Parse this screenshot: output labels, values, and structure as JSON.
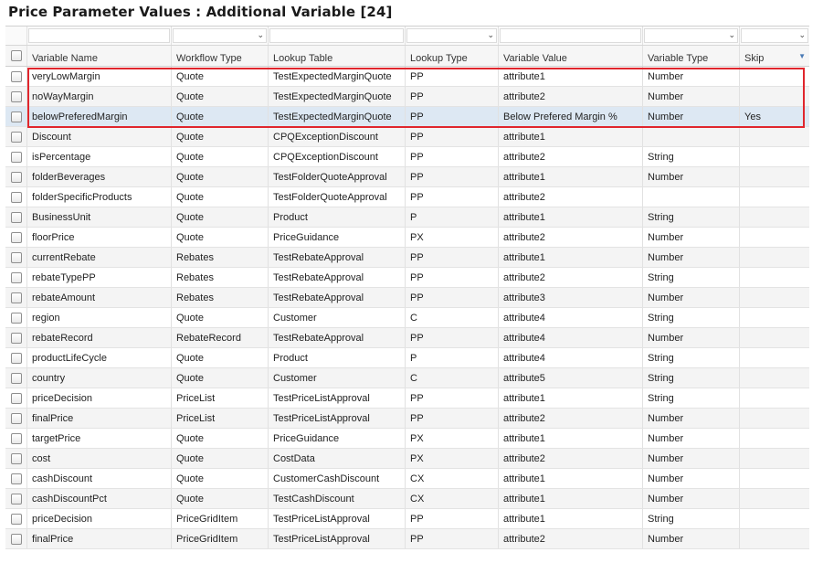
{
  "page": {
    "title": "Price Parameter Values : Additional Variable [24]"
  },
  "columns": [
    {
      "label": "Variable Name",
      "has_filter_dropdown": false
    },
    {
      "label": "Workflow Type",
      "has_filter_dropdown": true
    },
    {
      "label": "Lookup Table",
      "has_filter_dropdown": false
    },
    {
      "label": "Lookup Type",
      "has_filter_dropdown": true
    },
    {
      "label": "Variable Value",
      "has_filter_dropdown": false
    },
    {
      "label": "Variable Type",
      "has_filter_dropdown": true
    },
    {
      "label": "Skip",
      "has_filter_dropdown": true,
      "sort_indicator": "sort-desc-icon"
    }
  ],
  "rows": [
    [
      "veryLowMargin",
      "Quote",
      "TestExpectedMarginQuote",
      "PP",
      "attribute1",
      "Number",
      ""
    ],
    [
      "noWayMargin",
      "Quote",
      "TestExpectedMarginQuote",
      "PP",
      "attribute2",
      "Number",
      ""
    ],
    [
      "belowPreferedMargin",
      "Quote",
      "TestExpectedMarginQuote",
      "PP",
      "Below Prefered Margin %",
      "Number",
      "Yes"
    ],
    [
      "Discount",
      "Quote",
      "CPQExceptionDiscount",
      "PP",
      "attribute1",
      "",
      ""
    ],
    [
      "isPercentage",
      "Quote",
      "CPQExceptionDiscount",
      "PP",
      "attribute2",
      "String",
      ""
    ],
    [
      "folderBeverages",
      "Quote",
      "TestFolderQuoteApproval",
      "PP",
      "attribute1",
      "Number",
      ""
    ],
    [
      "folderSpecificProducts",
      "Quote",
      "TestFolderQuoteApproval",
      "PP",
      "attribute2",
      "",
      ""
    ],
    [
      "BusinessUnit",
      "Quote",
      "Product",
      "P",
      "attribute1",
      "String",
      ""
    ],
    [
      "floorPrice",
      "Quote",
      "PriceGuidance",
      "PX",
      "attribute2",
      "Number",
      ""
    ],
    [
      "currentRebate",
      "Rebates",
      "TestRebateApproval",
      "PP",
      "attribute1",
      "Number",
      ""
    ],
    [
      "rebateTypePP",
      "Rebates",
      "TestRebateApproval",
      "PP",
      "attribute2",
      "String",
      ""
    ],
    [
      "rebateAmount",
      "Rebates",
      "TestRebateApproval",
      "PP",
      "attribute3",
      "Number",
      ""
    ],
    [
      "region",
      "Quote",
      "Customer",
      "C",
      "attribute4",
      "String",
      ""
    ],
    [
      "rebateRecord",
      "RebateRecord",
      "TestRebateApproval",
      "PP",
      "attribute4",
      "Number",
      ""
    ],
    [
      "productLifeCycle",
      "Quote",
      "Product",
      "P",
      "attribute4",
      "String",
      ""
    ],
    [
      "country",
      "Quote",
      "Customer",
      "C",
      "attribute5",
      "String",
      ""
    ],
    [
      "priceDecision",
      "PriceList",
      "TestPriceListApproval",
      "PP",
      "attribute1",
      "String",
      ""
    ],
    [
      "finalPrice",
      "PriceList",
      "TestPriceListApproval",
      "PP",
      "attribute2",
      "Number",
      ""
    ],
    [
      "targetPrice",
      "Quote",
      "PriceGuidance",
      "PX",
      "attribute1",
      "Number",
      ""
    ],
    [
      "cost",
      "Quote",
      "CostData",
      "PX",
      "attribute2",
      "Number",
      ""
    ],
    [
      "cashDiscount",
      "Quote",
      "CustomerCashDiscount",
      "CX",
      "attribute1",
      "Number",
      ""
    ],
    [
      "cashDiscountPct",
      "Quote",
      "TestCashDiscount",
      "CX",
      "attribute1",
      "Number",
      ""
    ],
    [
      "priceDecision",
      "PriceGridItem",
      "TestPriceListApproval",
      "PP",
      "attribute1",
      "String",
      ""
    ],
    [
      "finalPrice",
      "PriceGridItem",
      "TestPriceListApproval",
      "PP",
      "attribute2",
      "Number",
      ""
    ]
  ],
  "selected_row_index": 2,
  "highlighted_row_indices": [
    0,
    1,
    2
  ],
  "colors": {
    "highlight_border": "#e0262d",
    "selected_row": "#dde8f3",
    "striped_row": "#f4f4f4"
  }
}
